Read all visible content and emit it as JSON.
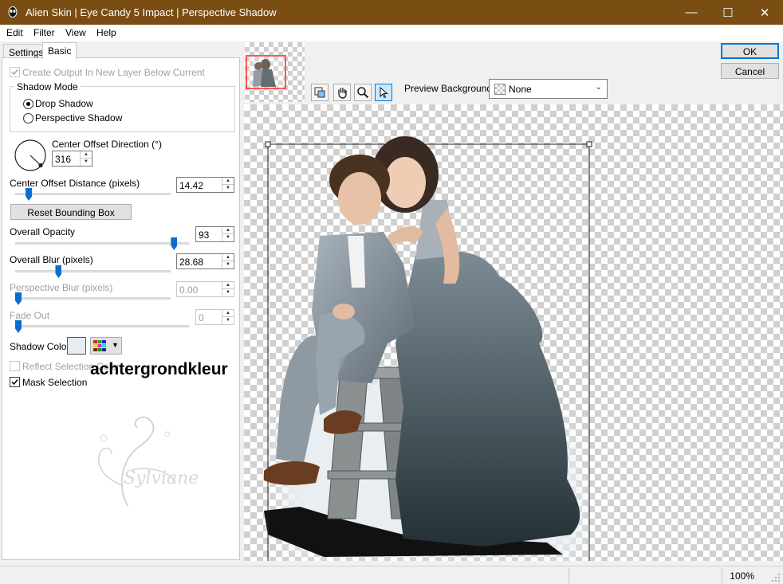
{
  "window": {
    "title": "Alien Skin | Eye Candy 5 Impact | Perspective Shadow",
    "minimize_glyph": "—",
    "maximize_glyph": "☐",
    "close_glyph": "✕"
  },
  "menu": [
    {
      "label": "Edit"
    },
    {
      "label": "Filter"
    },
    {
      "label": "View"
    },
    {
      "label": "Help"
    }
  ],
  "tabs": {
    "settings": "Settings",
    "basic": "Basic"
  },
  "controls": {
    "create_output": "Create Output In New Layer Below Current",
    "shadow_mode": "Shadow Mode",
    "drop_shadow": "Drop Shadow",
    "perspective_shadow": "Perspective Shadow",
    "center_offset_direction": "Center Offset Direction (°)",
    "center_offset_direction_value": "316",
    "center_offset_distance": "Center Offset Distance (pixels)",
    "center_offset_distance_value": "14.42",
    "reset_bounding_box": "Reset Bounding Box",
    "overall_opacity": "Overall Opacity",
    "overall_opacity_value": "93",
    "overall_blur": "Overall Blur (pixels)",
    "overall_blur_value": "28.68",
    "perspective_blur": "Perspective Blur (pixels)",
    "perspective_blur_value": "0.00",
    "fade_out": "Fade Out",
    "fade_out_value": "0",
    "shadow_color": "Shadow Color",
    "reflect_selection_color": "Reflect Selection Color",
    "mask_selection": "Mask Selection",
    "overlay_note": "achtergrondkleur"
  },
  "slider_levels": {
    "center_offset_distance": 0.07,
    "overall_opacity": 0.93,
    "overall_blur": 0.27,
    "perspective_blur": 0.0,
    "fade_out": 0.0
  },
  "buttons": {
    "ok": "OK",
    "cancel": "Cancel"
  },
  "preview": {
    "background_label": "Preview Background:",
    "background_value": "None"
  },
  "watermark": "Sylviane",
  "status": {
    "zoom": "100%"
  },
  "colors": {
    "titlebar": "#7a4e12",
    "accent": "#0078d7",
    "shadow_color_swatch": "#e6ecf2"
  }
}
